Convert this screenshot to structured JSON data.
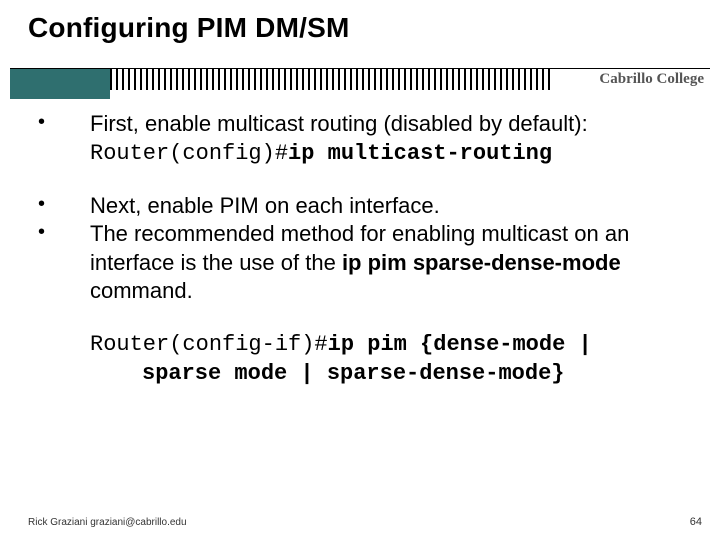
{
  "title": "Configuring PIM DM/SM",
  "brand": "Cabrillo College",
  "bullets": {
    "b1_text": "First, enable multicast routing (disabled by default):",
    "b1_code_prompt": "Router(config)#",
    "b1_code_cmd": "ip multicast-routing",
    "b2_text": "Next, enable PIM on each interface.",
    "b3_text_pre": "The recommended method for enabling multicast on an interface is the use of the ",
    "b3_bold": "ip pim sparse-dense-mode",
    "b3_text_post": " command."
  },
  "cmd": {
    "line1_prompt": "Router(config-if)#",
    "line1_bold": "ip pim {dense-mode |",
    "line2_bold": "sparse mode | sparse-dense-mode}"
  },
  "footer": {
    "left": "Rick Graziani  graziani@cabrillo.edu",
    "page": "64"
  }
}
